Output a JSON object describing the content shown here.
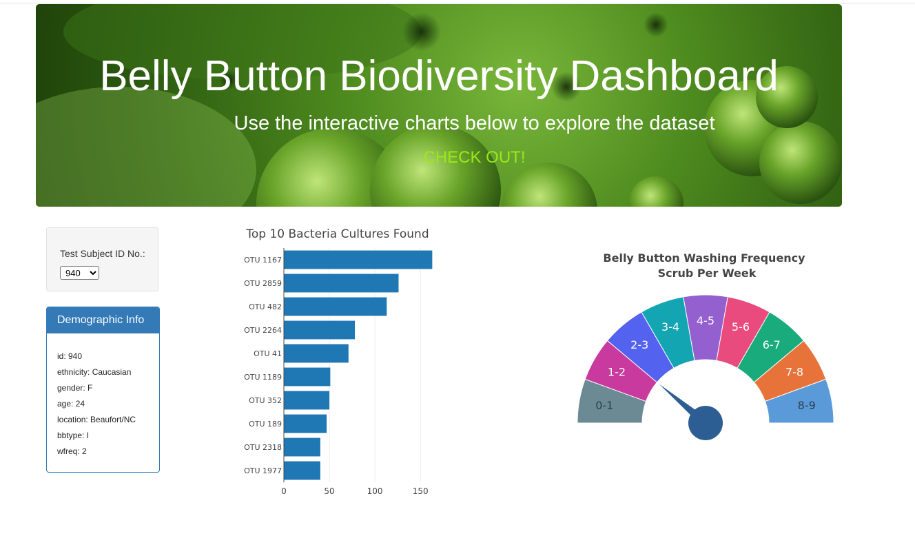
{
  "header": {
    "title": "Belly Button Biodiversity Dashboard",
    "subtitle": "Use the interactive charts below to explore the dataset",
    "link_label": "CHECK OUT!"
  },
  "selector": {
    "label": "Test Subject ID No.:",
    "selected_value": "940"
  },
  "demographic": {
    "heading": "Demographic Info",
    "lines": [
      "id: 940",
      "ethnicity: Caucasian",
      "gender: F",
      "age: 24",
      "location: Beaufort/NC",
      "bbtype: I",
      "wfreq: 2"
    ]
  },
  "colors": {
    "bar": "#1f77b4",
    "panel_primary": "#337ab7",
    "link": "#9be81a",
    "gauge_needle": "#2c5e94"
  },
  "chart_data": [
    {
      "type": "bar",
      "orientation": "horizontal",
      "title": "Top 10 Bacteria Cultures Found",
      "categories": [
        "OTU 1167",
        "OTU 2859",
        "OTU 482",
        "OTU 2264",
        "OTU 41",
        "OTU 1189",
        "OTU 352",
        "OTU 189",
        "OTU 2318",
        "OTU 1977"
      ],
      "values": [
        163,
        126,
        113,
        78,
        71,
        51,
        50,
        47,
        40,
        40
      ],
      "xlim": [
        0,
        165
      ],
      "xticks": [
        "0",
        "50",
        "100",
        "150"
      ],
      "grid": true
    },
    {
      "type": "gauge",
      "title": "Belly Button Washing Frequency",
      "subtitle": "Scrub Per Week",
      "segments": [
        {
          "label": "0-1",
          "color": "#6b8a93"
        },
        {
          "label": "1-2",
          "color": "#c93a9e"
        },
        {
          "label": "2-3",
          "color": "#5462f0"
        },
        {
          "label": "3-4",
          "color": "#14a5b2"
        },
        {
          "label": "4-5",
          "color": "#9460cf"
        },
        {
          "label": "5-6",
          "color": "#ea4b7f"
        },
        {
          "label": "6-7",
          "color": "#1aab7c"
        },
        {
          "label": "7-8",
          "color": "#e8733a"
        },
        {
          "label": "8-9",
          "color": "#5b9ad9"
        }
      ],
      "range": [
        0,
        9
      ],
      "value": 2
    }
  ]
}
